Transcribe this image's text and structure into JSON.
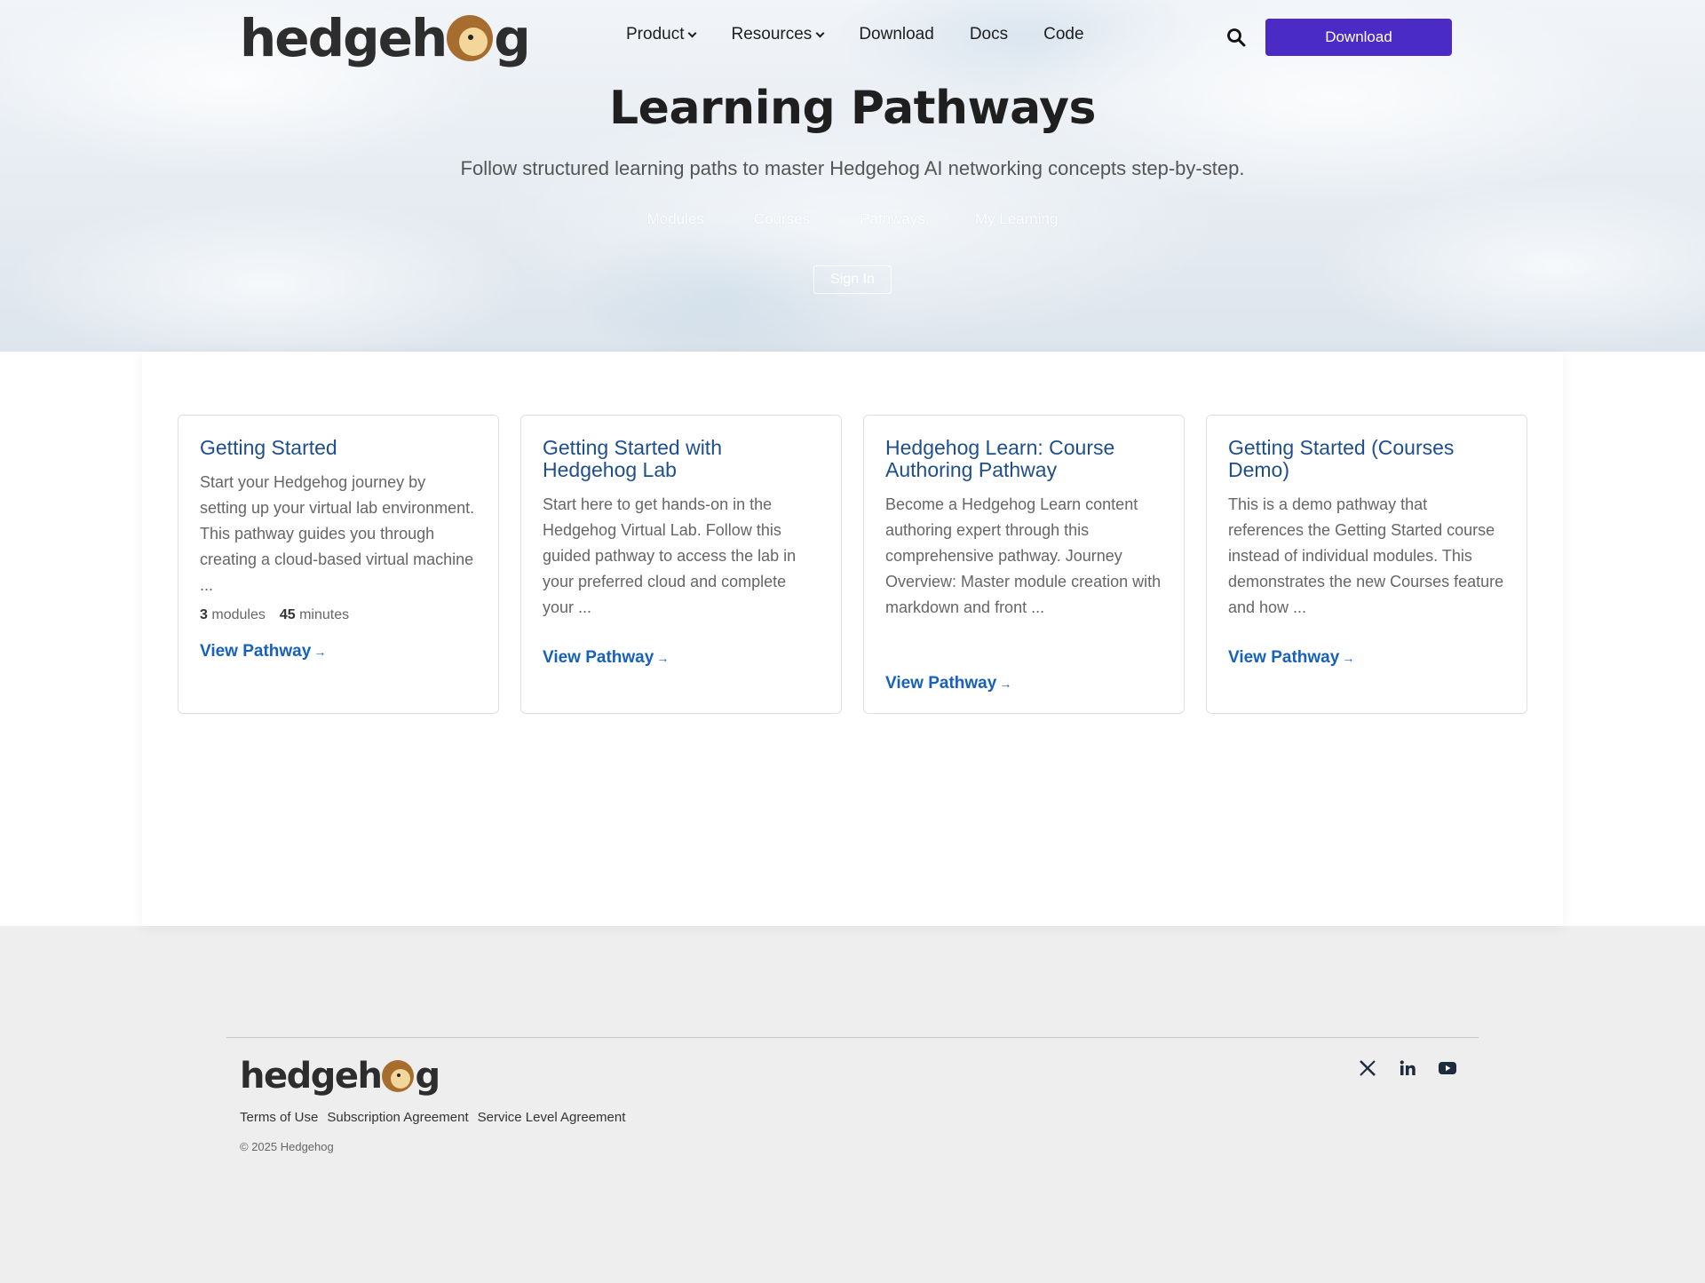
{
  "brand": {
    "logo_prefix": "hedgeh",
    "logo_suffix": "g",
    "name": "hedgehog"
  },
  "nav": {
    "items": [
      {
        "label": "Product",
        "dropdown": true
      },
      {
        "label": "Resources",
        "dropdown": true
      },
      {
        "label": "Download",
        "dropdown": false
      },
      {
        "label": "Docs",
        "dropdown": false
      },
      {
        "label": "Code",
        "dropdown": false
      }
    ],
    "search_icon": "search-icon",
    "cta_label": "Download"
  },
  "hero": {
    "title": "Learning Pathways",
    "subtitle": "Follow structured learning paths to master Hedgehog AI networking concepts step-by-step.",
    "tabs": [
      "Modules",
      "Courses",
      "Pathways",
      "My Learning"
    ],
    "signin_label": "Sign In"
  },
  "cards": [
    {
      "title": "Getting Started",
      "description": "Start your Hedgehog journey by setting up your virtual lab environment. This pathway guides you through creating a cloud-based virtual machine ...",
      "modules_count": "3",
      "modules_label": "modules",
      "minutes_count": "45",
      "minutes_label": "minutes",
      "link_label": "View Pathway"
    },
    {
      "title": "Getting Started with Hedgehog Lab",
      "description": "Start here to get hands-on in the Hedgehog Virtual Lab. Follow this guided pathway to access the lab in your preferred cloud and complete your ...",
      "link_label": "View Pathway"
    },
    {
      "title": "Hedgehog Learn: Course Authoring Pathway",
      "description": "Become a Hedgehog Learn content authoring expert through this comprehensive pathway. Journey Overview: Master module creation with markdown and front ...",
      "link_label": "View Pathway"
    },
    {
      "title": "Getting Started (Courses Demo)",
      "description": "This is a demo pathway that references the Getting Started course instead of individual modules. This demonstrates the new Courses feature and how ...",
      "link_label": "View Pathway"
    }
  ],
  "footer": {
    "links": [
      "Terms of Use",
      "Subscription Agreement",
      "Service Level Agreement"
    ],
    "copyright": "© 2025 Hedgehog",
    "social": [
      "x-icon",
      "linkedin-icon",
      "youtube-icon"
    ]
  },
  "colors": {
    "accent": "#4a2bc6",
    "card_title": "#1f4f8a",
    "link": "#1762b8"
  }
}
